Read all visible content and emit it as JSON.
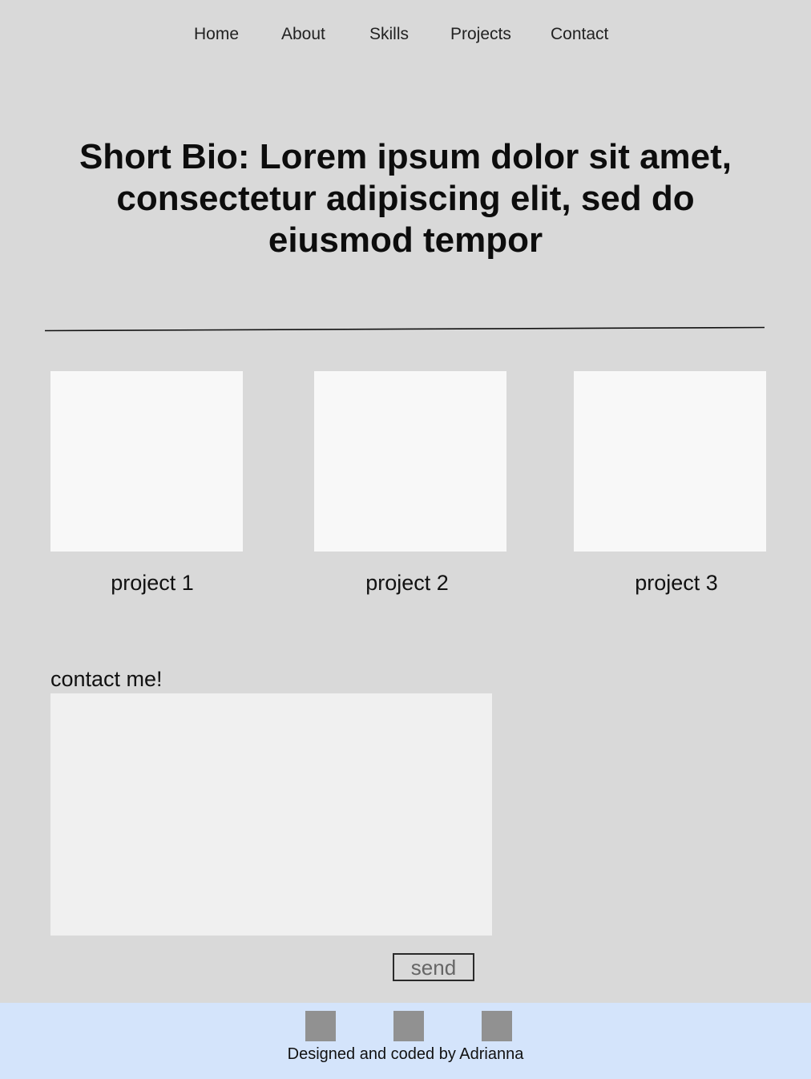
{
  "nav": {
    "items": [
      "Home",
      "About",
      "Skills",
      "Projects",
      "Contact"
    ]
  },
  "bio": {
    "text": "Short Bio: Lorem ipsum dolor sit amet, consectetur adipiscing elit, sed do eiusmod tempor"
  },
  "projects": [
    {
      "label": "project 1"
    },
    {
      "label": "project 2"
    },
    {
      "label": "project 3"
    }
  ],
  "contact": {
    "title": "contact me!",
    "message_value": "",
    "send_label": "send"
  },
  "footer": {
    "social_icons": [
      "social-icon",
      "social-icon",
      "social-icon"
    ],
    "credit": "Designed and coded by Adrianna"
  },
  "colors": {
    "page_background": "#d9d9d9",
    "card_background": "#f8f8f8",
    "textarea_background": "#f0f0f0",
    "footer_background": "#d4e4fb",
    "icon_placeholder": "#919191"
  }
}
